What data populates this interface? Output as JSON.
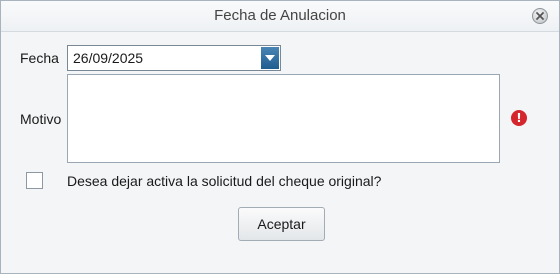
{
  "window": {
    "title": "Fecha de Anulacion"
  },
  "form": {
    "fecha_label": "Fecha",
    "fecha_value": "26/09/2025",
    "motivo_label": "Motivo",
    "motivo_value": "",
    "error_icon_glyph": "!",
    "checkbox_label": "Desea dejar activa la solicitud del cheque original?",
    "checkbox_checked": false
  },
  "buttons": {
    "accept_label": "Aceptar"
  },
  "colors": {
    "error": "#d6262d",
    "dropdown_accent": "#2a6a9d"
  },
  "icons": {
    "close": "close-icon",
    "dropdown": "chevron-down-icon",
    "error": "error-icon"
  }
}
